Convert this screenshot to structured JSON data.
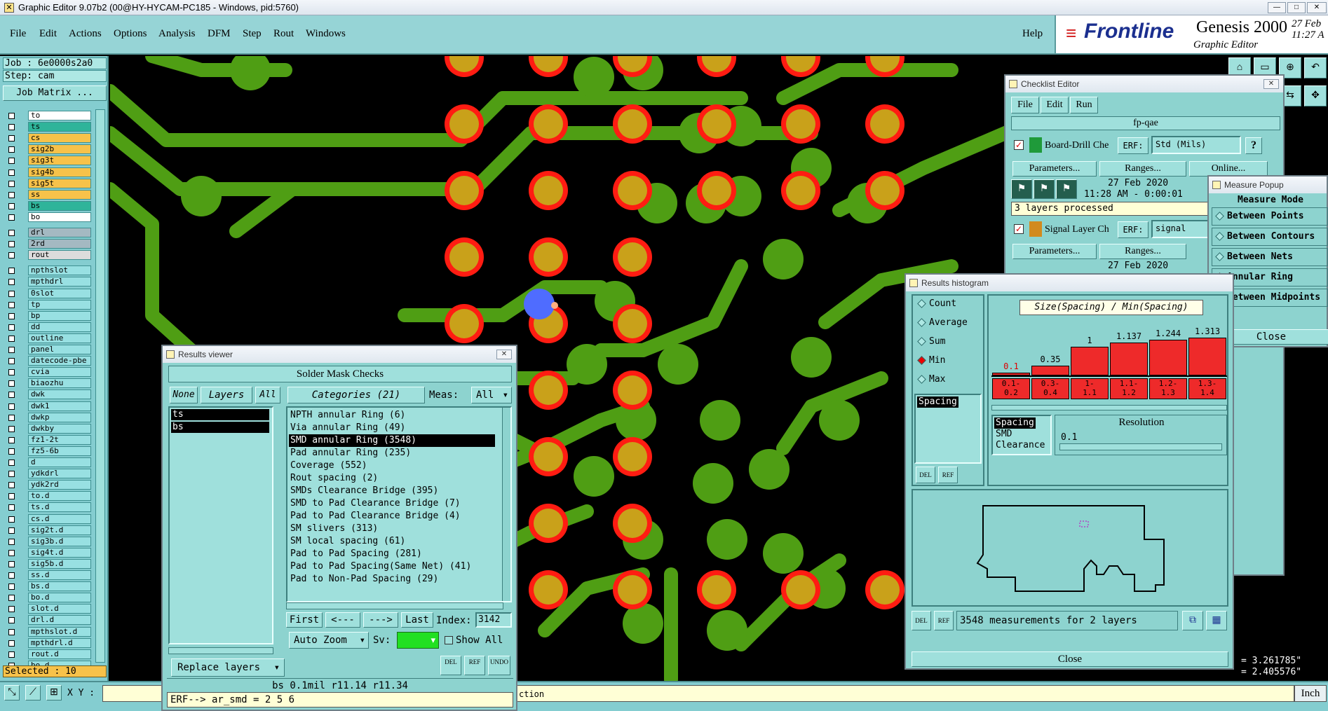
{
  "titlebar": {
    "title": "Graphic Editor 9.07b2 (00@HY-HYCAM-PC185 - Windows, pid:5760)"
  },
  "menu": {
    "items": [
      "File",
      "Edit",
      "Actions",
      "Options",
      "Analysis",
      "DFM",
      "Step",
      "Rout",
      "Windows"
    ],
    "help": "Help"
  },
  "logo": {
    "brand": "Frontline",
    "product": "Genesis 2000",
    "subtitle": "Graphic Editor",
    "date": "27 Feb",
    "time": "11:27 A"
  },
  "job": {
    "job_label": "Job : 6e0000s2a0",
    "step_label": "Step: cam",
    "matrix_button": "Job Matrix ..."
  },
  "layers": [
    {
      "name": "to",
      "color": "#ffffff"
    },
    {
      "name": "ts",
      "color": "#2fb49a"
    },
    {
      "name": "cs",
      "color": "#f7c24a"
    },
    {
      "name": "sig2b",
      "color": "#f7c24a"
    },
    {
      "name": "sig3t",
      "color": "#f7c24a"
    },
    {
      "name": "sig4b",
      "color": "#f7c24a"
    },
    {
      "name": "sig5t",
      "color": "#f7c24a"
    },
    {
      "name": "ss",
      "color": "#f7c24a"
    },
    {
      "name": "bs",
      "color": "#2fb49a"
    },
    {
      "name": "bo",
      "color": "#ffffff"
    },
    {
      "name": "drl",
      "color": "#a4b9c2"
    },
    {
      "name": "2rd",
      "color": "#a4b9c2"
    },
    {
      "name": "rout",
      "color": "#dcdcdc"
    },
    {
      "name": "npthslot",
      "color": "#98e0e2"
    },
    {
      "name": "mpthdrl",
      "color": "#98e0e2"
    },
    {
      "name": "0slot",
      "color": "#98e0e2"
    },
    {
      "name": "tp",
      "color": "#98e0e2"
    },
    {
      "name": "bp",
      "color": "#98e0e2"
    },
    {
      "name": "dd",
      "color": "#98e0e2"
    },
    {
      "name": "outline",
      "color": "#98e0e2"
    },
    {
      "name": "panel",
      "color": "#98e0e2"
    },
    {
      "name": "datecode-pbe",
      "color": "#98e0e2"
    },
    {
      "name": "cvia",
      "color": "#98e0e2"
    },
    {
      "name": "biaozhu",
      "color": "#98e0e2"
    },
    {
      "name": "dwk",
      "color": "#98e0e2"
    },
    {
      "name": "dwk1",
      "color": "#98e0e2"
    },
    {
      "name": "dwkp",
      "color": "#98e0e2"
    },
    {
      "name": "dwkby",
      "color": "#98e0e2"
    },
    {
      "name": "fz1-2t",
      "color": "#98e0e2"
    },
    {
      "name": "fz5-6b",
      "color": "#98e0e2"
    },
    {
      "name": "d",
      "color": "#98e0e2"
    },
    {
      "name": "ydkdrl",
      "color": "#98e0e2"
    },
    {
      "name": "ydk2rd",
      "color": "#98e0e2"
    },
    {
      "name": "to.d",
      "color": "#98e0e2"
    },
    {
      "name": "ts.d",
      "color": "#98e0e2"
    },
    {
      "name": "cs.d",
      "color": "#98e0e2"
    },
    {
      "name": "sig2t.d",
      "color": "#98e0e2"
    },
    {
      "name": "sig3b.d",
      "color": "#98e0e2"
    },
    {
      "name": "sig4t.d",
      "color": "#98e0e2"
    },
    {
      "name": "sig5b.d",
      "color": "#98e0e2"
    },
    {
      "name": "ss.d",
      "color": "#98e0e2"
    },
    {
      "name": "bs.d",
      "color": "#98e0e2"
    },
    {
      "name": "bo.d",
      "color": "#98e0e2"
    },
    {
      "name": "slot.d",
      "color": "#98e0e2"
    },
    {
      "name": "drl.d",
      "color": "#98e0e2"
    },
    {
      "name": "mpthslot.d",
      "color": "#98e0e2"
    },
    {
      "name": "mpthdrl.d",
      "color": "#98e0e2"
    },
    {
      "name": "rout.d",
      "color": "#98e0e2"
    },
    {
      "name": "bo.d",
      "color": "#98e0e2"
    }
  ],
  "selected_label": "Selected : 10",
  "statusbar": {
    "xy_label": "X Y :",
    "erf": "ERF--> ar_smd = 2 5 6",
    "info": "ction",
    "unit": "Inch",
    "coord_x": "= 3.261785\"",
    "coord_y": "= 2.405576\""
  },
  "results_viewer": {
    "title": "Results viewer",
    "header": "Solder Mask Checks",
    "none": "None",
    "layers": "Layers",
    "all": "All",
    "categories_btn": "Categories (21)",
    "meas_label": "Meas:",
    "meas_value": "All",
    "layer_list": [
      "ts",
      "bs"
    ],
    "categories": [
      "NPTH annular Ring (6)",
      "Via annular Ring (49)",
      "SMD annular Ring (3548)",
      "Pad annular Ring (235)",
      "Coverage (552)",
      "Rout spacing (2)",
      "SMDs Clearance Bridge (395)",
      "SMD to Pad Clearance Bridge (7)",
      "Pad to Pad Clearance Bridge (4)",
      "SM slivers (313)",
      "SM local spacing (61)",
      "Pad to Pad Spacing (281)",
      "Pad to Pad Spacing(Same Net) (41)",
      "Pad to Non-Pad Spacing (29)"
    ],
    "first": "First",
    "prev": "<---",
    "next": "--->",
    "last": "Last",
    "index_label": "Index:",
    "index_value": "3142",
    "auto_zoom": "Auto Zoom",
    "sv_label": "Sv:",
    "show_all": "Show All",
    "replace_layers": "Replace layers",
    "del": "DEL",
    "ref": "REF",
    "undo": "UNDO",
    "status": "bs 0.1mil  r11.14  r11.34"
  },
  "checklist": {
    "title": "Checklist Editor",
    "menu": [
      "File",
      "Edit",
      "Run"
    ],
    "name": "fp-qae",
    "item1": "Board-Drill Che",
    "erf_label": "ERF:",
    "erf1": "Std (Mils)",
    "q": "?",
    "params": "Parameters...",
    "ranges": "Ranges...",
    "online": "Online...",
    "date1": "27 Feb 2020",
    "time1": "11:28 AM - 0:00:01",
    "processed": "3 layers processed",
    "item2": "Signal Layer Ch",
    "erf2": "signal",
    "date2": "27 Feb 2020"
  },
  "measure": {
    "title": "Measure Popup",
    "mode": "Measure Mode",
    "options": [
      "Between Points",
      "Between Contours",
      "Between Nets",
      "Annular Ring",
      "Between Midpoints"
    ],
    "close": "Close"
  },
  "histogram": {
    "title": "Results histogram",
    "radios": [
      "Count",
      "Average",
      "Sum",
      "Min",
      "Max"
    ],
    "selected": "Min",
    "chart_title": "Size(Spacing) / Min(Spacing)",
    "list1": [
      "Spacing"
    ],
    "list2": [
      "Spacing",
      "SMD",
      "Clearance"
    ],
    "resolution_label": "Resolution",
    "resolution": "0.1",
    "del": "DEL",
    "ref": "REF",
    "summary": "3548 measurements for 2 layers",
    "close": "Close"
  },
  "chart_data": {
    "type": "bar",
    "title": "Size(Spacing) / Min(Spacing)",
    "categories": [
      "0.1-0.2",
      "0.3-0.4",
      "1-1.1",
      "1.1-1.2",
      "1.2-1.3",
      "1.3-1.4"
    ],
    "values": [
      0.1,
      0.35,
      1,
      1.137,
      1.244,
      1.313
    ],
    "value_labels": [
      "0.1",
      "0.35",
      "1",
      "1.137",
      "1.244",
      "1.313"
    ],
    "bin_lines": [
      [
        "0.1-",
        "0.2"
      ],
      [
        "0.3-",
        "0.4"
      ],
      [
        "1-",
        "1.1"
      ],
      [
        "1.1-",
        "1.2"
      ],
      [
        "1.2-",
        "1.3"
      ],
      [
        "1.3-",
        "1.4"
      ]
    ]
  },
  "colors": {
    "pad_ring": "#ff1c12",
    "pad_center": "#c9a11a",
    "trace": "#4f9e14",
    "teal": "#8dd3cf"
  }
}
